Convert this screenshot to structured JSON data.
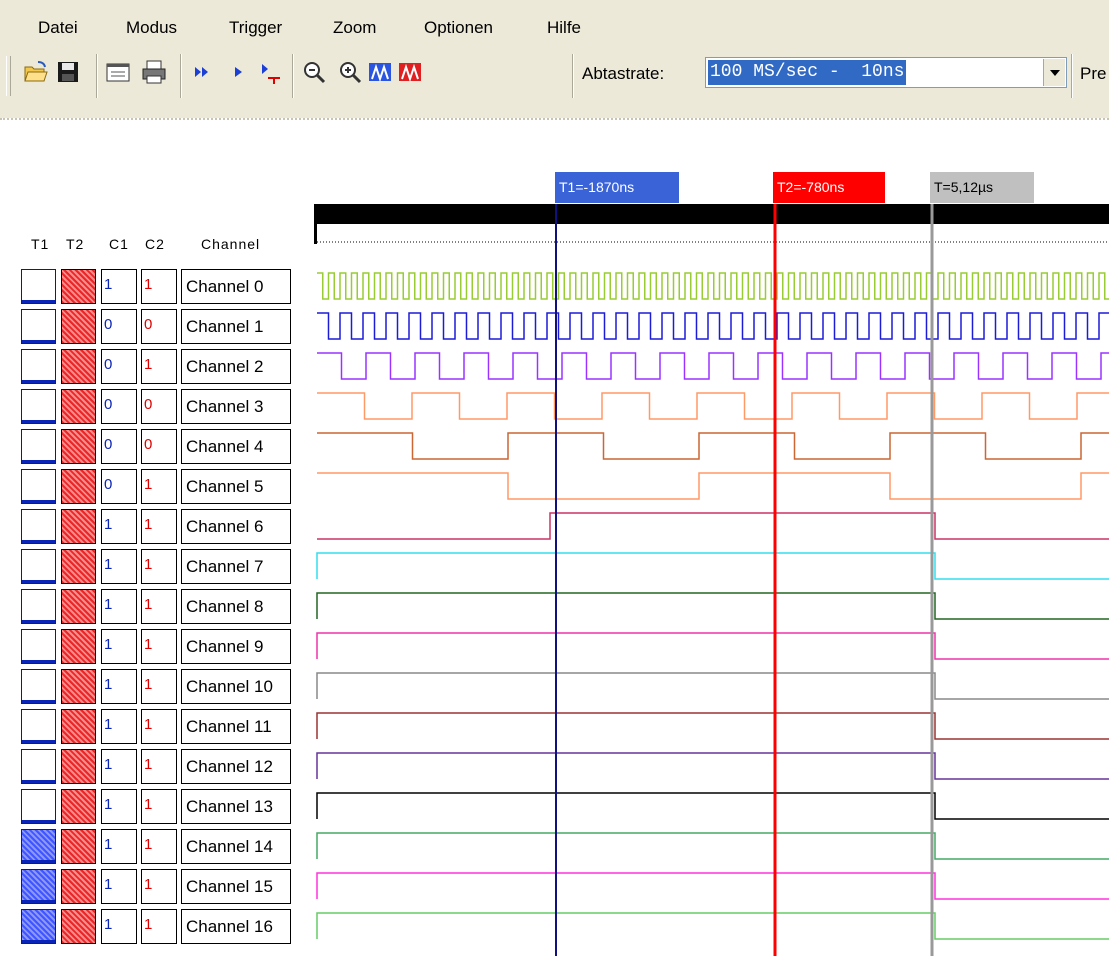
{
  "menu": [
    "Datei",
    "Modus",
    "Trigger",
    "Zoom",
    "Optionen",
    "Hilfe"
  ],
  "toolbar": {
    "buttons": [
      {
        "name": "open-folder-icon"
      },
      {
        "name": "save-disk-icon"
      },
      {
        "name": "window-icon"
      },
      {
        "name": "print-icon"
      },
      {
        "name": "run-continuous-icon"
      },
      {
        "name": "run-single-icon"
      },
      {
        "name": "run-trigger-icon"
      },
      {
        "name": "zoom-out-icon"
      },
      {
        "name": "zoom-in-icon"
      },
      {
        "name": "cursor-t1-icon"
      },
      {
        "name": "cursor-t2-icon"
      }
    ],
    "sample_rate_label": "Abtastrate:",
    "sample_rate_value": "100 MS/sec -  10ns",
    "truncated_label": "Pre"
  },
  "headers": {
    "t1": "T1",
    "t2": "T2",
    "c1": "C1",
    "c2": "C2",
    "channel": "Channel"
  },
  "markers": {
    "t1": {
      "label": "T1=-1870ns",
      "color": "#3a63d8"
    },
    "t2": {
      "label": "T2=-780ns",
      "color": "#ff0000"
    },
    "t": {
      "label": "T=5,12µs",
      "color": "#c0c0c0"
    }
  },
  "channels": [
    {
      "name": "Channel 0",
      "c1": "1",
      "c2": "1",
      "t1_on": false
    },
    {
      "name": "Channel 1",
      "c1": "0",
      "c2": "0",
      "t1_on": false
    },
    {
      "name": "Channel 2",
      "c1": "0",
      "c2": "1",
      "t1_on": false
    },
    {
      "name": "Channel 3",
      "c1": "0",
      "c2": "0",
      "t1_on": false
    },
    {
      "name": "Channel 4",
      "c1": "0",
      "c2": "0",
      "t1_on": false
    },
    {
      "name": "Channel 5",
      "c1": "0",
      "c2": "1",
      "t1_on": false
    },
    {
      "name": "Channel 6",
      "c1": "1",
      "c2": "1",
      "t1_on": false
    },
    {
      "name": "Channel 7",
      "c1": "1",
      "c2": "1",
      "t1_on": false
    },
    {
      "name": "Channel 8",
      "c1": "1",
      "c2": "1",
      "t1_on": false
    },
    {
      "name": "Channel 9",
      "c1": "1",
      "c2": "1",
      "t1_on": false
    },
    {
      "name": "Channel 10",
      "c1": "1",
      "c2": "1",
      "t1_on": false
    },
    {
      "name": "Channel 11",
      "c1": "1",
      "c2": "1",
      "t1_on": false
    },
    {
      "name": "Channel 12",
      "c1": "1",
      "c2": "1",
      "t1_on": false
    },
    {
      "name": "Channel 13",
      "c1": "1",
      "c2": "1",
      "t1_on": false
    },
    {
      "name": "Channel 14",
      "c1": "1",
      "c2": "1",
      "t1_on": true
    },
    {
      "name": "Channel 15",
      "c1": "1",
      "c2": "1",
      "t1_on": true
    },
    {
      "name": "Channel 16",
      "c1": "1",
      "c2": "1",
      "t1_on": true
    }
  ],
  "wave_colors": [
    "#99cc33",
    "#1c1cd6",
    "#9933ff",
    "#ff9966",
    "#cc6633",
    "#ff9966",
    "#cc3366",
    "#33ddee",
    "#226622",
    "#ee33aa",
    "#888888",
    "#993333",
    "#663399",
    "#000000",
    "#44aa66",
    "#ff33dd",
    "#66cc66"
  ]
}
